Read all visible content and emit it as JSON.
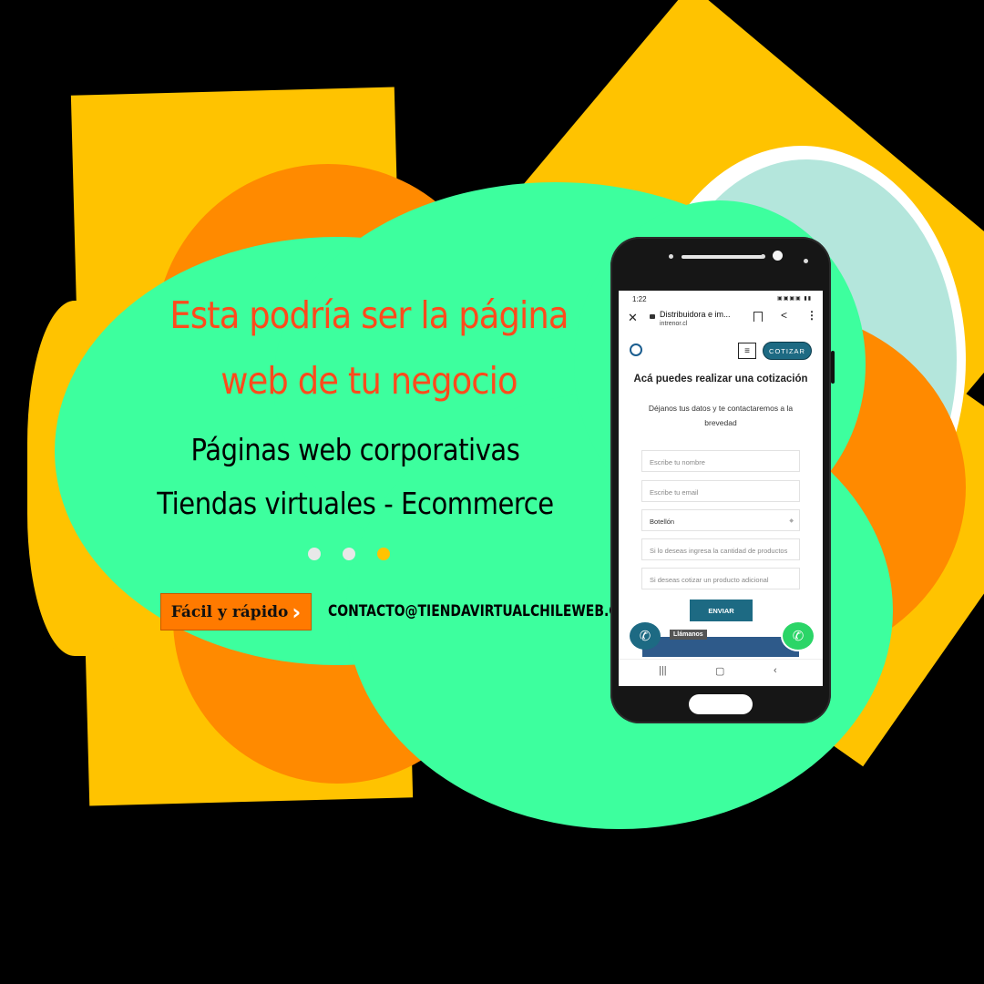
{
  "headline": {
    "line1": "Esta podría ser la página",
    "line2": "web de tu negocio"
  },
  "subheadline": {
    "line1": "Páginas web corporativas",
    "line2": "Tiendas virtuales - Ecommerce"
  },
  "carousel": {
    "count": 3,
    "active_index": 2
  },
  "cta": {
    "label": "Fácil y rápido",
    "arrow": "›"
  },
  "contact_email": "CONTACTO@TIENDAVIRTUALCHILEWEB.CL",
  "colors": {
    "background": "#000000",
    "yellow": "#FFC300",
    "orange": "#FF8A00",
    "green": "#3DFF9E",
    "headline": "#FF4A1C",
    "site_accent": "#1D6A83"
  },
  "phone": {
    "status_time": "1:22",
    "url_title": "Distribuidora e im...",
    "url_domain": "intrenor.cl",
    "close_icon": "close-icon",
    "share_icon": "share-icon",
    "more_icon": "more-vertical-icon",
    "cotizar_label": "COTIZAR",
    "form_title": "Acá puedes realizar una cotización",
    "form_subtitle": "Déjanos tus datos y te contactaremos a la brevedad",
    "fields": {
      "name_placeholder": "Escribe tu nombre",
      "email_placeholder": "Escribe tu email",
      "product_selected": "Botellón",
      "quantity_placeholder": "Si lo deseas ingresa la cantidad de productos",
      "extra_placeholder": "Si deseas cotizar un producto adicional"
    },
    "send_label": "ENVIAR",
    "call_label": "Llámanos"
  }
}
